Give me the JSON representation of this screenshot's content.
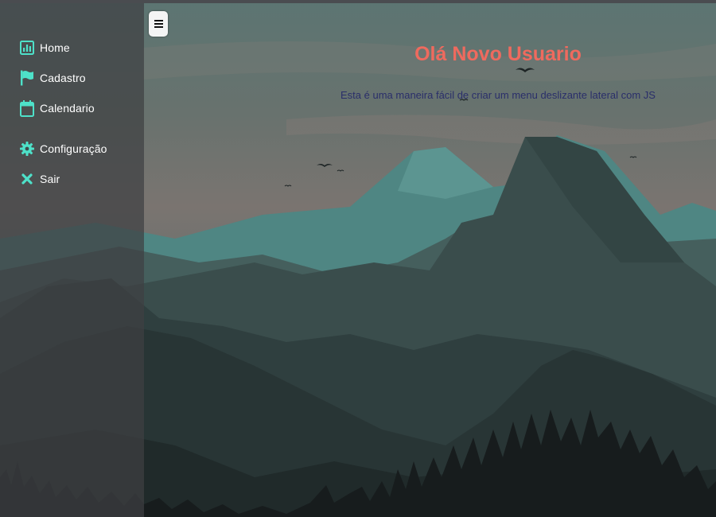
{
  "sidebar": {
    "items": [
      {
        "label": "Home",
        "icon": "bar-chart-icon"
      },
      {
        "label": "Cadastro",
        "icon": "flag-icon"
      },
      {
        "label": "Calendario",
        "icon": "calendar-icon"
      },
      {
        "label": "Configuração",
        "icon": "gear-icon"
      },
      {
        "label": "Sair",
        "icon": "close-icon"
      }
    ]
  },
  "header": {
    "toggle_icon": "hamburger-icon"
  },
  "main": {
    "title": "Olá Novo Usuario",
    "subtitle": "Esta é uma maneira fácil de criar um menu deslizante lateral com JS"
  },
  "colors": {
    "icon_accent": "#4ee1c9",
    "title": "#ef6a5e",
    "subtitle": "#2a2e6a",
    "sidebar_bg": "#3e4042"
  }
}
